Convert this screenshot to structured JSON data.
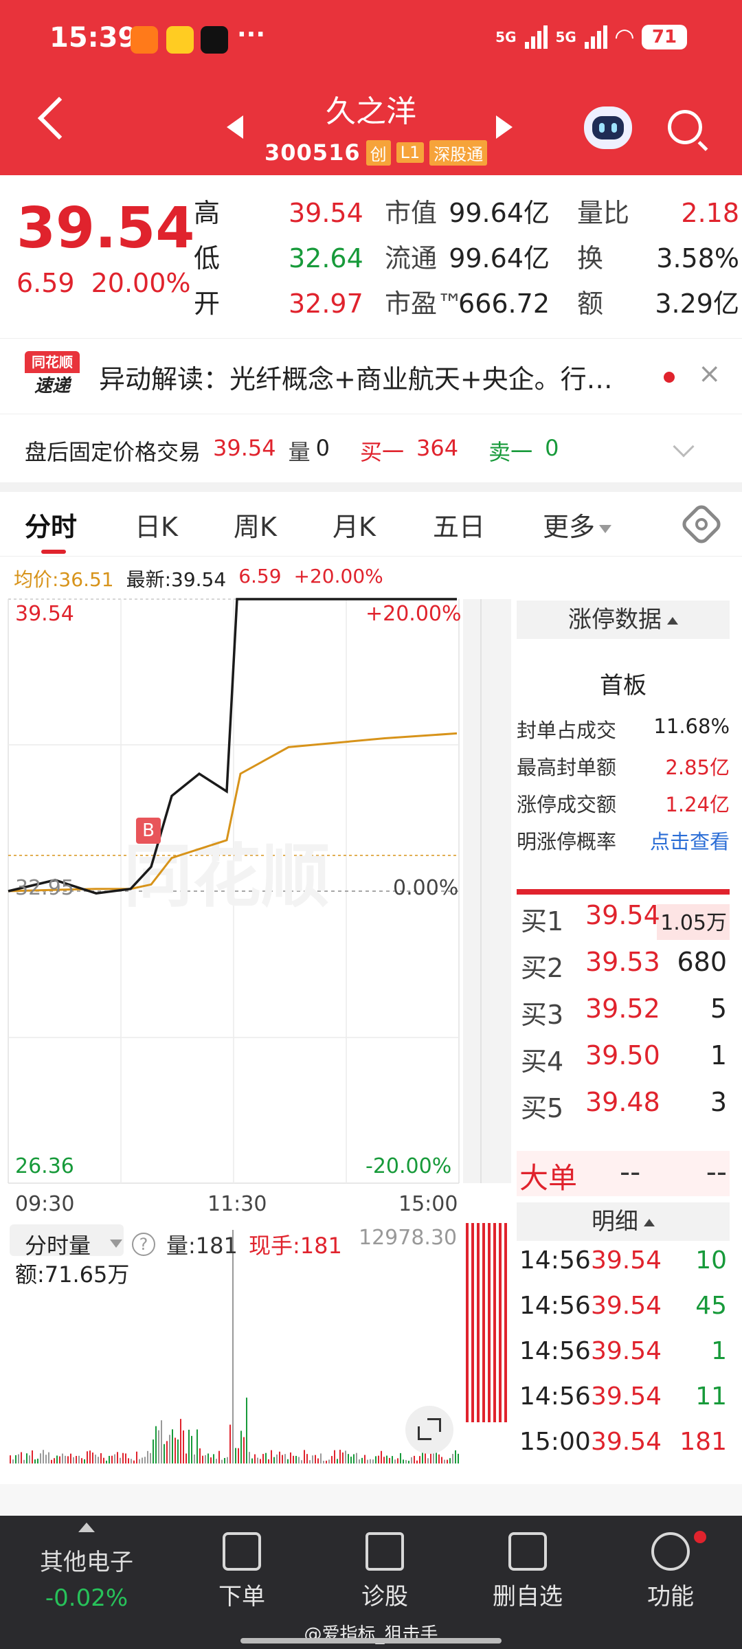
{
  "status": {
    "time": "15:39",
    "more": "···",
    "net1": "5G",
    "net2": "5G",
    "battery": "71"
  },
  "header": {
    "title": "久之洋",
    "code": "300516",
    "tags": [
      "创",
      "L1",
      "深股通"
    ]
  },
  "quote": {
    "price": "39.54",
    "change": "6.59",
    "change_pct": "20.00%",
    "col1": [
      {
        "k": "高",
        "v": "39.54",
        "c": "red"
      },
      {
        "k": "低",
        "v": "32.64",
        "c": "green"
      },
      {
        "k": "开",
        "v": "32.97",
        "c": "red"
      }
    ],
    "col2": [
      {
        "k": "市值",
        "v": "99.64亿"
      },
      {
        "k": "流通",
        "v": "99.64亿"
      },
      {
        "k": "市盈™",
        "v": "666.72"
      }
    ],
    "col3": [
      {
        "k": "量比",
        "v": "2.18",
        "c": "red"
      },
      {
        "k": "换",
        "v": "3.58%"
      },
      {
        "k": "额",
        "v": "3.29亿"
      }
    ]
  },
  "alert": {
    "logo_top": "同花顺",
    "logo_bottom": "速递",
    "text": "异动解读：光纤概念+商业航天+央企。行…",
    "close": "×"
  },
  "after_hours": {
    "label": "盘后固定价格交易",
    "price": "39.54",
    "vol_label": "量",
    "vol": "0",
    "buy_label": "买一",
    "buy": "364",
    "sell_label": "卖一",
    "sell": "0"
  },
  "tabs": [
    "分时",
    "日K",
    "周K",
    "月K",
    "五日",
    "更多"
  ],
  "chart_header": {
    "avg": "均价:36.51",
    "latest": "最新:39.54",
    "chg": "6.59",
    "pct": "+20.00%"
  },
  "axes": {
    "y_top": "39.54",
    "y_bottom": "26.36",
    "y_mid": "32.95",
    "pct_top": "+20.00%",
    "pct_mid": "0.00%",
    "pct_bottom": "-20.00%",
    "t0": "09:30",
    "t1": "11:30",
    "t2": "15:00",
    "watermark": "同花顺",
    "marker": "B"
  },
  "volume": {
    "selector": "分时量",
    "help": "?",
    "vol": "量:181",
    "hand": "现手:181",
    "amount": "额:71.65万",
    "max": "12978.30"
  },
  "limit_panel": {
    "head": "涨停数据",
    "title": "首板",
    "rows": [
      {
        "k": "封单占成交",
        "v": "11.68%",
        "c": ""
      },
      {
        "k": "最高封单额",
        "v": "2.85亿",
        "c": "red"
      },
      {
        "k": "涨停成交额",
        "v": "1.24亿",
        "c": "red"
      },
      {
        "k": "明涨停概率",
        "v": "点击查看",
        "c": "blue"
      }
    ]
  },
  "orderbook": [
    {
      "label": "买1",
      "price": "39.54",
      "qty": "1.05万"
    },
    {
      "label": "买2",
      "price": "39.53",
      "qty": "680"
    },
    {
      "label": "买3",
      "price": "39.52",
      "qty": "5"
    },
    {
      "label": "买4",
      "price": "39.50",
      "qty": "1"
    },
    {
      "label": "买5",
      "price": "39.48",
      "qty": "3"
    }
  ],
  "big_order": {
    "label": "大单",
    "v1": "--",
    "v2": "--"
  },
  "detail": {
    "head": "明细",
    "ticks": [
      {
        "t": "14:56",
        "p": "39.54",
        "v": "10",
        "c": "green"
      },
      {
        "t": "14:56",
        "p": "39.54",
        "v": "45",
        "c": "green"
      },
      {
        "t": "14:56",
        "p": "39.54",
        "v": "1",
        "c": "green"
      },
      {
        "t": "14:56",
        "p": "39.54",
        "v": "11",
        "c": "green"
      },
      {
        "t": "15:00",
        "p": "39.54",
        "v": "181",
        "c": "red"
      }
    ]
  },
  "bottom_nav": {
    "sector": "其他电子",
    "sector_chg": "-0.02%",
    "items": [
      "下单",
      "诊股",
      "删自选",
      "功能"
    ]
  },
  "watermark_text": "@爱指标_狙击手",
  "chart_data": {
    "type": "line",
    "x": [
      "09:30",
      "11:30",
      "15:00"
    ],
    "series": [
      {
        "name": "最新",
        "values": [
          32.95,
          33.2,
          32.9,
          33.0,
          33.5,
          35.1,
          35.6,
          35.2,
          39.54,
          39.54,
          39.54,
          39.54
        ]
      },
      {
        "name": "均价",
        "values": [
          32.95,
          32.98,
          33.0,
          33.0,
          33.1,
          33.7,
          33.9,
          34.1,
          35.6,
          36.2,
          36.4,
          36.51
        ]
      }
    ],
    "ylim": [
      26.36,
      39.54
    ],
    "reference": 32.95
  },
  "colors": {
    "header_red": "#e8333b",
    "up": "#e0232d",
    "down": "#179a3a",
    "avg": "#d7931a"
  }
}
